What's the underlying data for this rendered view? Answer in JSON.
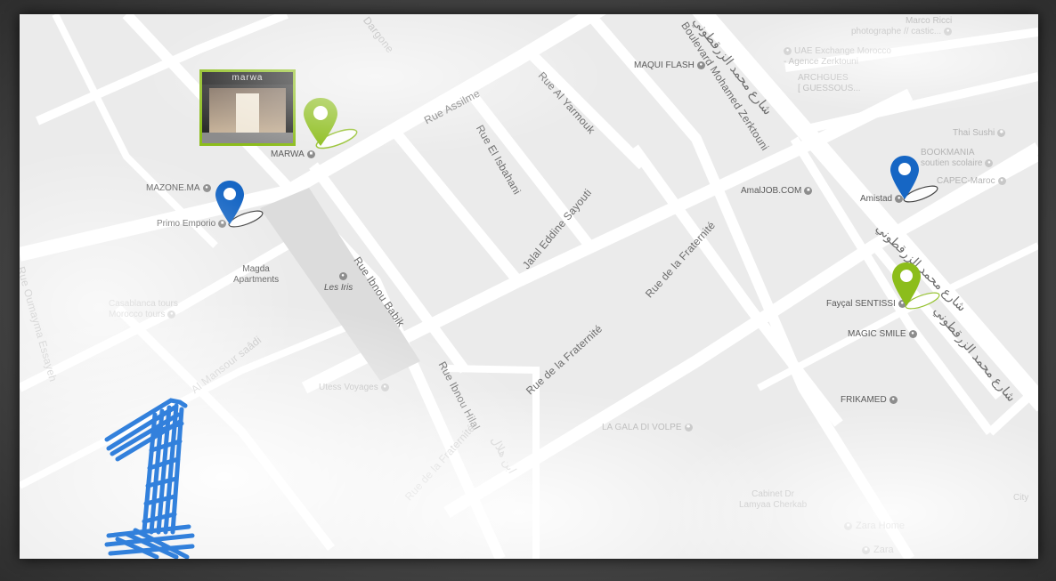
{
  "map": {
    "points_of_interest": [
      {
        "id": "marwa",
        "name": "MARWA",
        "icon": "shopping-icon"
      },
      {
        "id": "mazone",
        "name": "MAZONE.MA",
        "icon": "place-icon"
      },
      {
        "id": "primo",
        "name": "Primo Emporio",
        "icon": "shopping-icon"
      },
      {
        "id": "magda",
        "name": "Magda\nApartments",
        "icon": ""
      },
      {
        "id": "lesiris",
        "name": "Les Iris",
        "icon": "place-icon"
      },
      {
        "id": "casablanca_tours",
        "name": "Casablanca tours\nMorocco tours",
        "icon": "place-icon"
      },
      {
        "id": "utess",
        "name": "Utess Voyages",
        "icon": "place-icon"
      },
      {
        "id": "maqui",
        "name": "MAQUI FLASH",
        "icon": "place-icon"
      },
      {
        "id": "amaljob",
        "name": "AmalJOB.COM",
        "icon": "building-icon"
      },
      {
        "id": "uae",
        "name": "UAE Exchange Morocco\n- Agence Zerktouni",
        "icon": "place-icon"
      },
      {
        "id": "archgues",
        "name": "ARCHGUES\n[ GUESSOUS...",
        "icon": ""
      },
      {
        "id": "marco",
        "name": "Marco Ricci\nphotographe // castic...",
        "icon": "place-icon"
      },
      {
        "id": "thai",
        "name": "Thai Sushi",
        "icon": "restaurant-icon"
      },
      {
        "id": "bookmania",
        "name": "BOOKMANIA\nsoutien scolaire",
        "icon": "place-icon"
      },
      {
        "id": "capec",
        "name": "CAPEC-Maroc",
        "icon": "place-icon"
      },
      {
        "id": "amistad",
        "name": "Amistad",
        "icon": "place-icon"
      },
      {
        "id": "faycal",
        "name": "Fayçal SENTISSI",
        "icon": "place-icon"
      },
      {
        "id": "magicsmile",
        "name": "MAGIC SMILE",
        "icon": "place-icon"
      },
      {
        "id": "frikamed",
        "name": "FRIKAMED",
        "icon": "place-icon"
      },
      {
        "id": "lagala",
        "name": "LA GALA DI VOLPE",
        "icon": "restaurant-icon"
      },
      {
        "id": "cabinet",
        "name": "Cabinet Dr\nLamyaa Cherkab",
        "icon": ""
      },
      {
        "id": "zarahome",
        "name": "Zara Home",
        "icon": "shopping-icon"
      },
      {
        "id": "zara",
        "name": "Zara",
        "icon": "shopping-icon"
      },
      {
        "id": "city",
        "name": "City",
        "icon": ""
      }
    ],
    "streets": [
      {
        "id": "assilme",
        "name": "Rue Assilme"
      },
      {
        "id": "yarmouk",
        "name": "Rue Al Yarmouk"
      },
      {
        "id": "isbahani",
        "name": "Rue El Isbahani"
      },
      {
        "id": "sayouti",
        "name": "Jalal Eddine Sayouti"
      },
      {
        "id": "fraternite1",
        "name": "Rue de la Fraternité"
      },
      {
        "id": "fraternite2",
        "name": "Rue de la Fraternité"
      },
      {
        "id": "ibnoubabik",
        "name": "Rue Ibnou Babik"
      },
      {
        "id": "ibnouhilal",
        "name": "Rue Ibnou Hilal"
      },
      {
        "id": "zerktouni",
        "name": "Boulevard Mohamed Zerktouni"
      },
      {
        "id": "arabic1",
        "name": "شارع محمد الزرقطوني"
      },
      {
        "id": "arabic2",
        "name": "شارع محمد الزرقطوني"
      },
      {
        "id": "arabic3",
        "name": "شارع محمد الزرقطوني"
      },
      {
        "id": "mansour",
        "name": "Al Mansour saâdi"
      },
      {
        "id": "oumayma",
        "name": "Rue Oumayma Essayeh"
      },
      {
        "id": "rdlf_faint",
        "name": "Rue de la Fraternité"
      },
      {
        "id": "ibnhilal_ar",
        "name": "ابن هلال"
      },
      {
        "id": "dargone",
        "name": "Dargone"
      }
    ],
    "markers": [
      {
        "id": "marker-marwa",
        "color": "#8cbd1b"
      },
      {
        "id": "marker-primo",
        "color": "#1666c4"
      },
      {
        "id": "marker-amistad",
        "color": "#1666c4"
      },
      {
        "id": "marker-faycal",
        "color": "#8cbd1b"
      }
    ],
    "store_photo": {
      "sign_text": "marwa"
    },
    "overlay_number": {
      "text": "1",
      "color": "#1d74d9"
    }
  }
}
